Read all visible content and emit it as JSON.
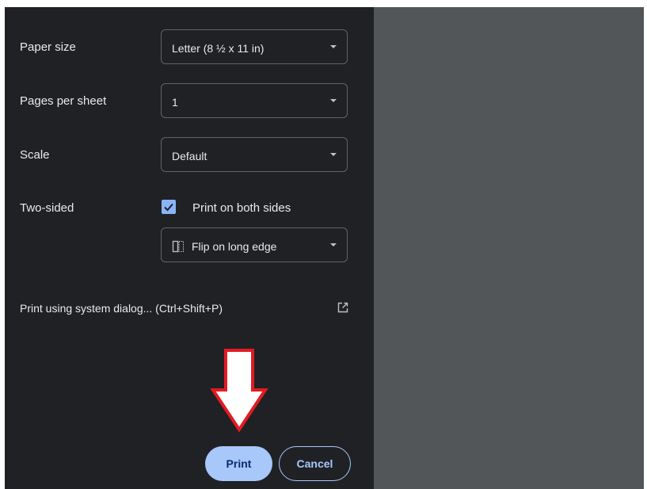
{
  "settings": {
    "paper_size": {
      "label": "Paper size",
      "value": "Letter (8 ½ x 11 in)"
    },
    "pages_per_sheet": {
      "label": "Pages per sheet",
      "value": "1"
    },
    "scale": {
      "label": "Scale",
      "value": "Default"
    },
    "two_sided": {
      "label": "Two-sided",
      "checkbox_label": "Print on both sides",
      "checked": true,
      "flip_value": "Flip on long edge"
    }
  },
  "system_dialog": {
    "label": "Print using system dialog... (Ctrl+Shift+P)",
    "icon": "open-in-new-icon"
  },
  "buttons": {
    "print": "Print",
    "cancel": "Cancel"
  },
  "annotation": {
    "type": "down-arrow",
    "color": "#e31b23"
  },
  "colors": {
    "panel_bg": "#202124",
    "preview_bg": "#525659",
    "accent": "#a8c7fa",
    "checkbox": "#8ab4f8"
  }
}
